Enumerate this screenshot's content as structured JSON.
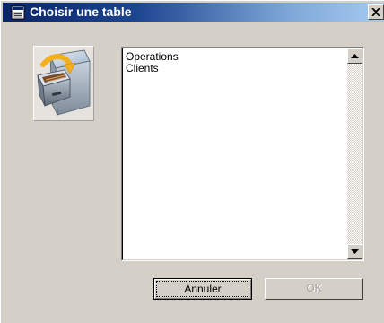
{
  "window": {
    "title": "Choisir une table",
    "icon": "app-window-icon",
    "close_icon": "close-icon"
  },
  "illustration": {
    "icon": "file-cabinet-icon"
  },
  "table_list": {
    "items": [
      {
        "label": "Operations"
      },
      {
        "label": "Clients"
      }
    ],
    "scroll_up_icon": "scroll-up-arrow-icon",
    "scroll_down_icon": "scroll-down-arrow-icon"
  },
  "buttons": {
    "cancel_label": "Annuler",
    "ok_label": "OK",
    "ok_enabled": false
  },
  "colors": {
    "face": "#d4d0c8",
    "titlebar_start": "#0a246a",
    "titlebar_end": "#a6caf0",
    "list_bg": "#ffffff",
    "disabled_text": "#a0a0a0"
  }
}
